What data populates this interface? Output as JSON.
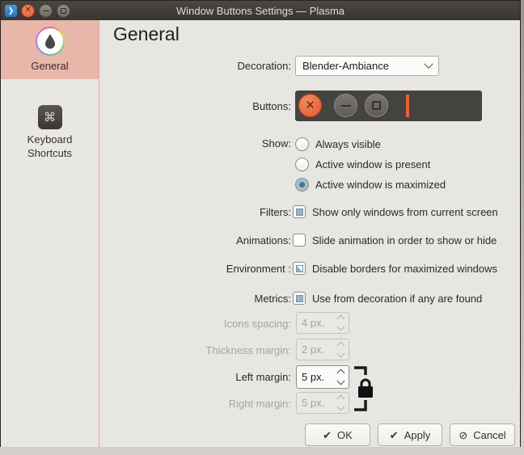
{
  "window": {
    "title": "Window Buttons Settings — Plasma"
  },
  "sidebar": {
    "items": [
      {
        "label": "General",
        "icon": "color-drop-icon",
        "selected": true
      },
      {
        "label": "Keyboard Shortcuts",
        "icon": "command-key-icon",
        "selected": false
      }
    ],
    "command_glyph": "⌘"
  },
  "main": {
    "heading": "General",
    "decoration": {
      "label": "Decoration:",
      "value": "Blender-Ambiance"
    },
    "buttons_preview": {
      "label": "Buttons:",
      "items": [
        "close",
        "minimize",
        "maximize"
      ],
      "close_glyph": "✕"
    },
    "show": {
      "label": "Show:",
      "options": [
        {
          "label": "Always visible",
          "selected": false
        },
        {
          "label": "Active window is present",
          "selected": false
        },
        {
          "label": "Active window is maximized",
          "selected": true
        }
      ]
    },
    "checkboxes": [
      {
        "label": "Filters:",
        "text": "Show only windows from current screen",
        "state": "checked"
      },
      {
        "label": "Animations:",
        "text": "Slide animation in order to show or hide",
        "state": "unchecked"
      },
      {
        "label": "Environment :",
        "text": "Disable borders for maximized windows",
        "state": "partial"
      },
      {
        "label": "Metrics:",
        "text": "Use from decoration if any are found",
        "state": "checked"
      }
    ],
    "spinners": [
      {
        "label": "Icons spacing:",
        "value": "4 px.",
        "enabled": false
      },
      {
        "label": "Thickness margin:",
        "value": "2 px.",
        "enabled": false
      },
      {
        "label": "Left margin:",
        "value": "5 px.",
        "enabled": true
      },
      {
        "label": "Right margin:",
        "value": "5 px.",
        "enabled": false
      }
    ]
  },
  "footer": {
    "ok": "OK",
    "apply": "Apply",
    "cancel": "Cancel",
    "check_glyph": "✔",
    "cancel_glyph": "⊘"
  },
  "colors": {
    "titlebar": "#3c3936",
    "close_button": "#e4572e",
    "selected_sidebar": "#e9b6aa",
    "preview_bar": "#454340",
    "drop_indicator": "#e8603a",
    "radio_selected_fill": "#a5c0d2",
    "checkbox_fill": "#93b4c7",
    "background": "#e8e6e2"
  }
}
